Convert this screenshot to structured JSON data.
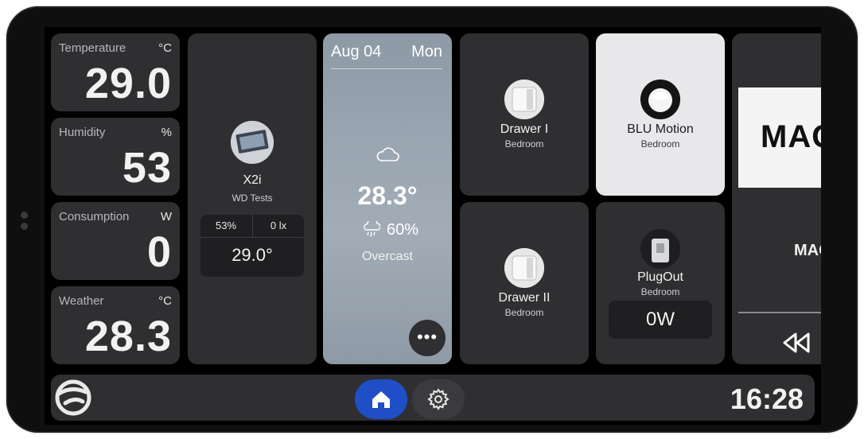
{
  "sensors": [
    {
      "label": "Temperature",
      "unit": "°C",
      "value": "29.0"
    },
    {
      "label": "Humidity",
      "unit": "%",
      "value": "53"
    },
    {
      "label": "Consumption",
      "unit": "W",
      "value": "0"
    },
    {
      "label": "Weather",
      "unit": "°C",
      "value": "28.3"
    }
  ],
  "x2i": {
    "name": "X2i",
    "room": "WD Tests",
    "humidity": "53%",
    "lux": "0 lx",
    "temperature": "29.0°"
  },
  "weather": {
    "date": "Aug 04",
    "day": "Mon",
    "temperature": "28.3°",
    "precip": "60%",
    "condition": "Overcast",
    "more_label": "•••"
  },
  "devices": {
    "drawer1": {
      "name": "Drawer I",
      "room": "Bedroom"
    },
    "blu": {
      "name": "BLU Motion",
      "room": "Bedroom"
    },
    "drawer2": {
      "name": "Drawer II",
      "room": "Bedroom"
    },
    "plugout": {
      "name": "PlugOut",
      "room": "Bedroom",
      "power": "0W"
    }
  },
  "media": {
    "art_text": "MAG",
    "title": "MAG"
  },
  "bottombar": {
    "clock": "16:28"
  },
  "colors": {
    "accent": "#1f4fc8",
    "card": "#2f2f31",
    "card_active": "#e8e8ea"
  }
}
